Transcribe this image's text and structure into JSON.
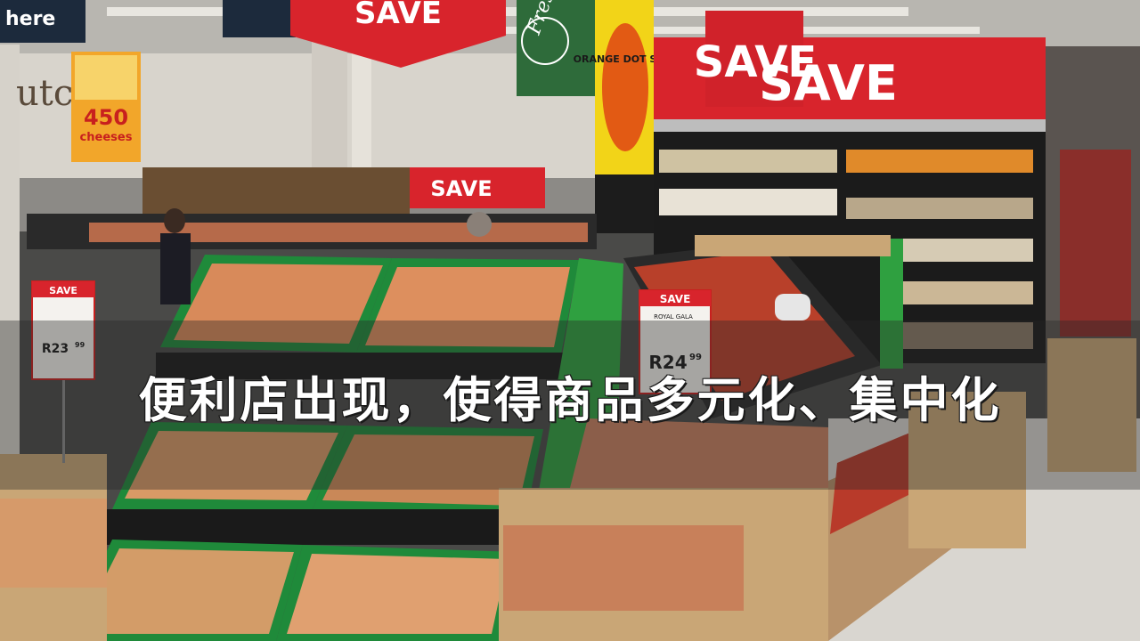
{
  "caption": {
    "part_outline": "便利店",
    "part_solid": "出现，使得商品多元化、集中化"
  },
  "signs": {
    "save": "SAVE",
    "here": "here",
    "cheeses_count": "450",
    "cheeses_label": "cheeses",
    "orange_dot": "ORANGE DOT SALE",
    "price_left": "R23",
    "price_left_cents": "99",
    "price_right": "R24",
    "price_right_cents": "99",
    "price_right_item": "ROYAL GALA",
    "fresh": "Fresh",
    "dutch": "utch"
  },
  "colors": {
    "save_red": "#d8242c",
    "crate_green": "#1f8a3a",
    "wood": "#c9a676",
    "floor": "#d9d6d0"
  }
}
